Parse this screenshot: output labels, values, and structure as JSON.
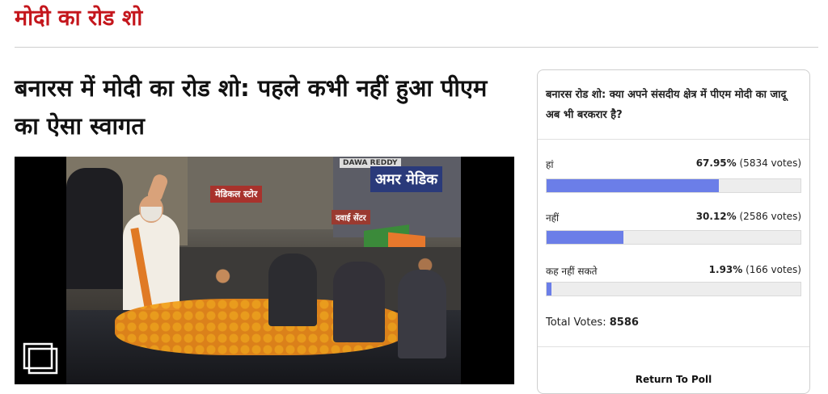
{
  "section": {
    "title": "मोदी का रोड शो"
  },
  "article": {
    "headline": "बनारस में मोदी का रोड शो: पहले कभी नहीं हुआ पीएम का ऐसा स्वागत"
  },
  "photo": {
    "signs": [
      "DAWA REDDY",
      "अमर मेडिक",
      "मेडिकल स्टोर",
      "दवाई सेंटर"
    ],
    "icon": "gallery-icon"
  },
  "poll": {
    "question": "बनारस रोड शो: क्या अपने संसदीय क्षेत्र में पीएम मोदी का जादू अब भी बरकरार है?",
    "options": [
      {
        "label": "हां",
        "percent": "67.95%",
        "votes": "(5834 votes)",
        "fraction": 0.6795
      },
      {
        "label": "नहीं",
        "percent": "30.12%",
        "votes": "(2586 votes)",
        "fraction": 0.3012
      },
      {
        "label": "कह नहीं सकते",
        "percent": "1.93%",
        "votes": "(166 votes)",
        "fraction": 0.0193
      }
    ],
    "total_label": "Total Votes:",
    "total_value": "8586",
    "return_label": "Return To Poll",
    "bar_color": "#6b7ee8"
  },
  "colors": {
    "accent": "#c4161c"
  }
}
